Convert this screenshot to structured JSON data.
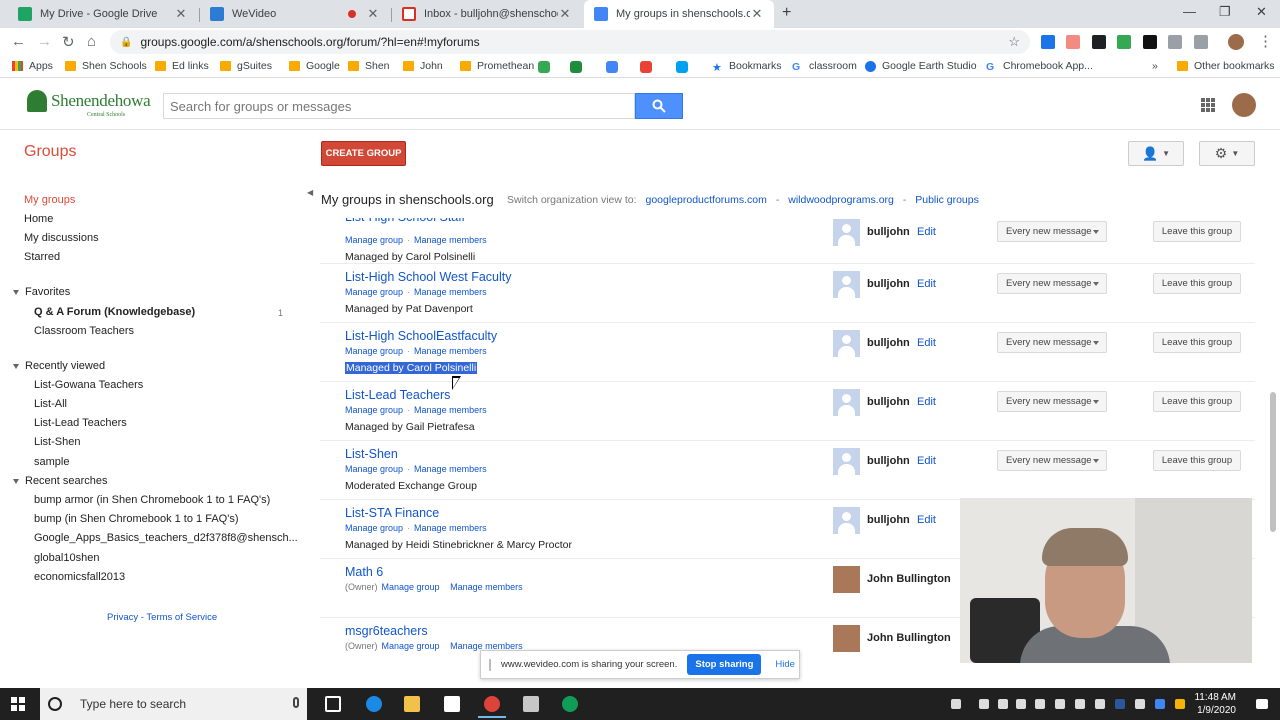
{
  "browser": {
    "tabs": [
      {
        "title": "My Drive - Google Drive",
        "color": "#1fa463"
      },
      {
        "title": "WeVideo",
        "color": "#2d7bd2"
      },
      {
        "title": "Inbox - bulljohn@shenschools.o",
        "color": "#d93025"
      },
      {
        "title": "My groups in shenschools.org - G",
        "color": "#4285f4"
      }
    ],
    "new_tab": "+",
    "url": "groups.google.com/a/shenschools.org/forum/?hl=en#!myforums",
    "window_controls": {
      "minimize": "—",
      "restore": "❐",
      "close": "✕"
    }
  },
  "bookmarks": [
    {
      "label": "Apps",
      "type": "apps"
    },
    {
      "label": "Shen Schools",
      "type": "folder"
    },
    {
      "label": "Ed links",
      "type": "folder"
    },
    {
      "label": "gSuites",
      "type": "folder"
    },
    {
      "label": "Google",
      "type": "folder"
    },
    {
      "label": "Shen",
      "type": "folder"
    },
    {
      "label": "John",
      "type": "folder"
    },
    {
      "label": "Promethean",
      "type": "folder"
    },
    {
      "label": "Bookmarks",
      "type": "star"
    },
    {
      "label": "classroom",
      "type": "g"
    },
    {
      "label": "Google Earth Studio",
      "type": "earth"
    },
    {
      "label": "Chromebook App...",
      "type": "g"
    },
    {
      "label": "»",
      "type": "more"
    },
    {
      "label": "Other bookmarks",
      "type": "folder"
    }
  ],
  "header": {
    "logo_text": "Shenendehowa",
    "logo_sub": "Central Schools",
    "search_placeholder": "Search for groups or messages"
  },
  "toolbar": {
    "title": "Groups",
    "create_label": "CREATE GROUP"
  },
  "sidebar": {
    "nav": [
      "My groups",
      "Home",
      "My discussions",
      "Starred"
    ],
    "favorites_title": "Favorites",
    "favorites": [
      "Q & A Forum (Knowledgebase)",
      "Classroom Teachers"
    ],
    "favorites_badge": "1",
    "recent_title": "Recently viewed",
    "recent": [
      "List-Gowana Teachers",
      "List-All",
      "List-Lead Teachers",
      "List-Shen",
      "sample"
    ],
    "searches_title": "Recent searches",
    "searches": [
      "bump armor (in Shen Chromebook 1 to 1 FAQ's)",
      "bump (in Shen Chromebook 1 to 1 FAQ's)",
      "Google_Apps_Basics_teachers_d2f378f8@shensch...",
      "global10shen",
      "economicsfall2013"
    ],
    "footer": "Privacy - Terms of Service"
  },
  "main": {
    "title": "My groups in shenschools.org",
    "switch_label": "Switch organization view to:",
    "switch_links": [
      "googleproductforums.com",
      "wildwoodprograms.org",
      "Public groups"
    ],
    "partial_top_name": "List-High School Staff",
    "manage_group": "Manage group",
    "manage_members": "Manage members",
    "owner_label": "(Owner)",
    "edit_label": "Edit",
    "freq_label": "Every new message",
    "leave_label": "Leave this group",
    "groups": [
      {
        "name": "",
        "managed": "Managed by Carol Polsinelli",
        "user": "bulljohn"
      },
      {
        "name": "List-High School West Faculty",
        "managed": "Managed by Pat Davenport",
        "user": "bulljohn"
      },
      {
        "name": "List-High SchoolEastfaculty",
        "managed": "Managed by Carol Polsinelli",
        "user": "bulljohn"
      },
      {
        "name": "List-Lead Teachers",
        "managed": "Managed by Gail Pietrafesa",
        "user": "bulljohn"
      },
      {
        "name": "List-Shen",
        "managed": "Moderated Exchange Group",
        "user": "bulljohn"
      },
      {
        "name": "List-STA Finance",
        "managed": "Managed by Heidi Stinebrickner & Marcy Proctor",
        "user": "bulljohn"
      },
      {
        "name": "Math 6",
        "managed": "",
        "user": "John Bullington"
      },
      {
        "name": "msgr6teachers",
        "managed": "",
        "user": "John Bullington"
      }
    ]
  },
  "sharebar": {
    "text": "www.wevideo.com is sharing your screen.",
    "stop": "Stop sharing",
    "hide": "Hide"
  },
  "taskbar": {
    "search_placeholder": "Type here to search",
    "time": "11:48 AM",
    "date": "1/9/2020"
  }
}
